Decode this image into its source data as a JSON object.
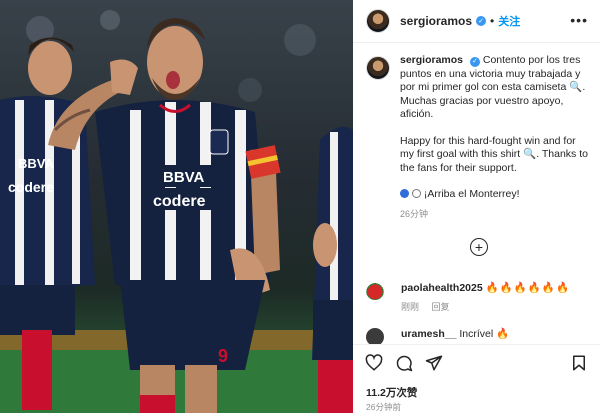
{
  "post": {
    "username": "sergioramos",
    "follow_label": "关注",
    "more_label": "•••",
    "verified_mark": "✓",
    "separator": "•",
    "photo_alt": "Football player celebrating a goal in a navy striped jersey"
  },
  "jersey": {
    "sponsor_top": "BBVA",
    "sponsor_bottom": "codere"
  },
  "caption": {
    "username": "sergioramos",
    "spanish_text": "Contento por los tres puntos en una victoria muy trabajada y por mi primer gol con esta camiseta",
    "spanish_text_end": ". Muchas gracias por vuestro apoyo, afición.",
    "english_text": "Happy for this hard-fought win and for my first goal with this shirt",
    "english_text_end": ". Thanks to the fans for their support.",
    "closing_text": "¡Arriba el Monterrey!",
    "time": "26分钟"
  },
  "load_more_label": "+",
  "comments": [
    {
      "username": "paolahealth2025",
      "text": "🔥🔥🔥🔥🔥🔥",
      "time": "刚刚",
      "reply_label": "回复",
      "avatar_color": "#d62828"
    },
    {
      "username": "uramesh__",
      "text": "Incrível",
      "emoji": "🔥",
      "avatar_color": "#3b3b3b"
    }
  ],
  "actions": {
    "likes": "11.2万次赞",
    "time": "26分钟前"
  },
  "colors": {
    "accent": "#0095f6",
    "verified": "#3897f0",
    "jersey_navy": "#14223f",
    "jersey_red": "#c8102e"
  },
  "icons": [
    "heart-icon",
    "comment-icon",
    "share-icon",
    "bookmark-icon",
    "add-circle-icon",
    "more-options-icon",
    "verified-icon"
  ]
}
